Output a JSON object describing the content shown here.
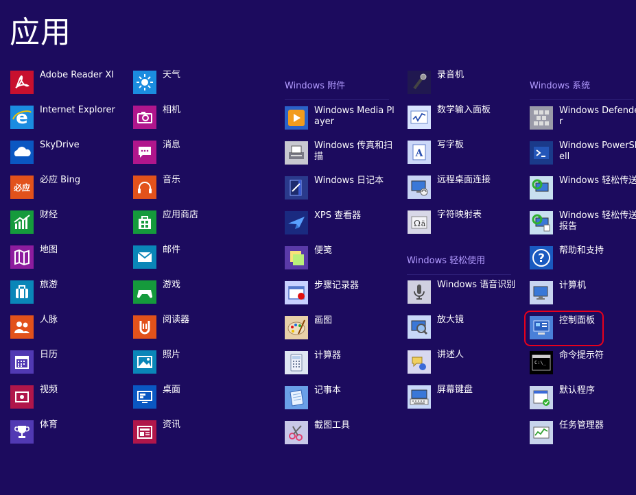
{
  "title": "应用",
  "groups": {
    "accessories": "Windows 附件",
    "ease": "Windows 轻松使用",
    "system": "Windows 系统"
  },
  "col1": [
    {
      "label": "Adobe Reader XI",
      "icon": "adobe-reader-icon"
    },
    {
      "label": "Internet Explorer",
      "icon": "internet-explorer-icon"
    },
    {
      "label": "SkyDrive",
      "icon": "skydrive-cloud-icon"
    },
    {
      "label": "必应 Bing",
      "icon": "bing-icon"
    },
    {
      "label": "财经",
      "icon": "finance-chart-icon"
    },
    {
      "label": "地图",
      "icon": "maps-icon"
    },
    {
      "label": "旅游",
      "icon": "travel-suitcase-icon"
    },
    {
      "label": "人脉",
      "icon": "people-icon"
    },
    {
      "label": "日历",
      "icon": "calendar-icon"
    },
    {
      "label": "视频",
      "icon": "video-icon"
    },
    {
      "label": "体育",
      "icon": "sports-trophy-icon"
    }
  ],
  "col2": [
    {
      "label": "天气",
      "icon": "weather-sun-icon"
    },
    {
      "label": "相机",
      "icon": "camera-icon"
    },
    {
      "label": "消息",
      "icon": "messaging-icon"
    },
    {
      "label": "音乐",
      "icon": "music-headphones-icon"
    },
    {
      "label": "应用商店",
      "icon": "store-bag-icon"
    },
    {
      "label": "邮件",
      "icon": "mail-envelope-icon"
    },
    {
      "label": "游戏",
      "icon": "games-controller-icon"
    },
    {
      "label": "阅读器",
      "icon": "reader-icon"
    },
    {
      "label": "照片",
      "icon": "photos-icon"
    },
    {
      "label": "桌面",
      "icon": "desktop-icon"
    },
    {
      "label": "资讯",
      "icon": "news-icon"
    }
  ],
  "col3": [
    {
      "label": "Windows Media Player",
      "icon": "media-player-icon"
    },
    {
      "label": "Windows 传真和扫描",
      "icon": "fax-scan-icon"
    },
    {
      "label": "Windows 日记本",
      "icon": "journal-icon"
    },
    {
      "label": "XPS 查看器",
      "icon": "xps-viewer-icon"
    },
    {
      "label": "便笺",
      "icon": "sticky-notes-icon"
    },
    {
      "label": "步骤记录器",
      "icon": "steps-recorder-icon"
    },
    {
      "label": "画图",
      "icon": "paint-palette-icon"
    },
    {
      "label": "计算器",
      "icon": "calculator-icon"
    },
    {
      "label": "记事本",
      "icon": "notepad-icon"
    },
    {
      "label": "截图工具",
      "icon": "snipping-tool-icon"
    }
  ],
  "col4a": [
    {
      "label": "录音机",
      "icon": "sound-recorder-icon"
    },
    {
      "label": "数学输入面板",
      "icon": "math-input-icon"
    },
    {
      "label": "写字板",
      "icon": "wordpad-icon"
    },
    {
      "label": "远程桌面连接",
      "icon": "remote-desktop-icon"
    },
    {
      "label": "字符映射表",
      "icon": "character-map-icon"
    }
  ],
  "col4b": [
    {
      "label": "Windows 语音识别",
      "icon": "speech-recognition-icon"
    },
    {
      "label": "放大镜",
      "icon": "magnifier-icon"
    },
    {
      "label": "讲述人",
      "icon": "narrator-icon"
    },
    {
      "label": "屏幕键盘",
      "icon": "onscreen-keyboard-icon"
    }
  ],
  "col5": [
    {
      "label": "Windows Defender",
      "icon": "defender-icon"
    },
    {
      "label": "Windows PowerShell",
      "icon": "powershell-icon"
    },
    {
      "label": "Windows 轻松传送",
      "icon": "easy-transfer-icon"
    },
    {
      "label": "Windows 轻松传送报告",
      "icon": "easy-transfer-reports-icon"
    },
    {
      "label": "帮助和支持",
      "icon": "help-icon"
    },
    {
      "label": "计算机",
      "icon": "computer-icon"
    },
    {
      "label": "控制面板",
      "icon": "control-panel-icon"
    },
    {
      "label": "命令提示符",
      "icon": "command-prompt-icon"
    },
    {
      "label": "默认程序",
      "icon": "default-programs-icon"
    },
    {
      "label": "任务管理器",
      "icon": "task-manager-icon"
    }
  ],
  "colors": {
    "background": "#1c0b5e",
    "group_title": "#b29bff",
    "highlight": "#e8001c"
  }
}
